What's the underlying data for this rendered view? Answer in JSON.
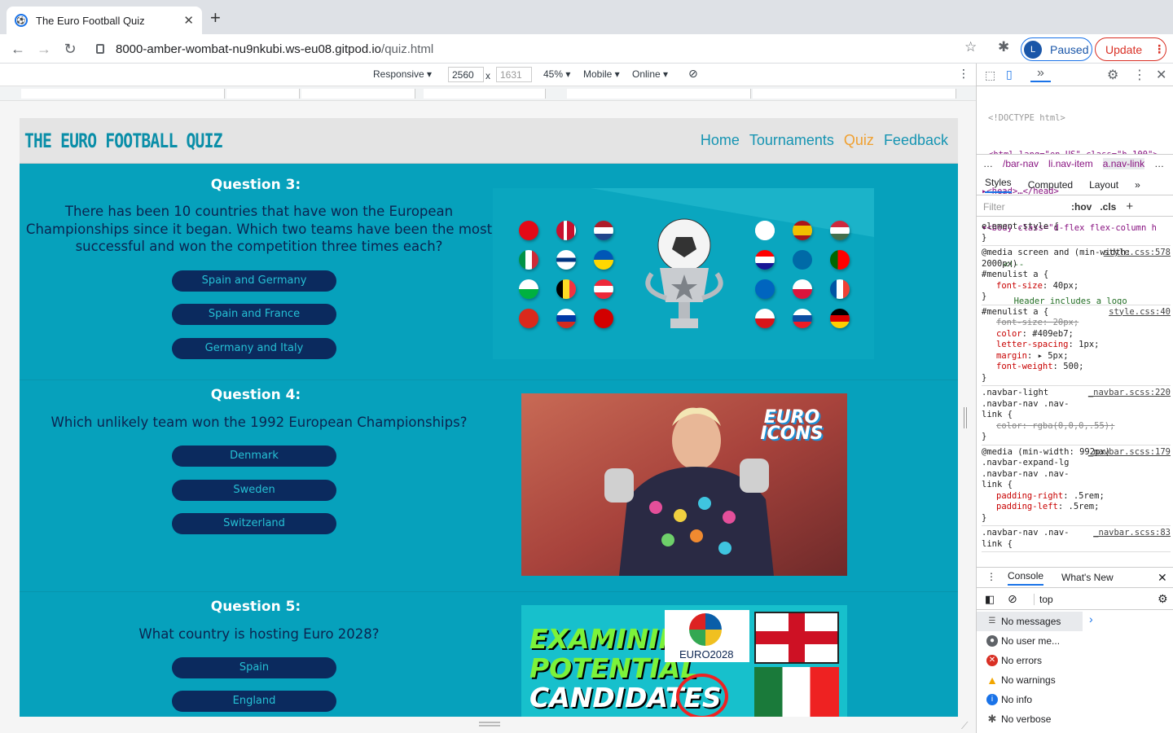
{
  "browser": {
    "tab_title": "The Euro Football Quiz",
    "tab_close": "✕",
    "new_tab": "+",
    "url_host": "8000-amber-wombat-nu9nkubi.ws-eu08.gitpod.io",
    "url_path": "/quiz.html",
    "profile_initial": "L",
    "profile_label": "Paused",
    "update_label": "Update"
  },
  "device_toolbar": {
    "mode": "Responsive ▾",
    "width": "2560",
    "times": "x",
    "height": "1631",
    "zoom": "45% ▾",
    "device": "Mobile ▾",
    "network": "Online ▾"
  },
  "page": {
    "logo": "THE EURO FOOTBALL QUIZ",
    "menu": [
      "Home",
      "Tournaments",
      "Quiz",
      "Feedback"
    ],
    "active_menu": "Quiz",
    "questions": [
      {
        "title": "Question 3:",
        "text": "There has been 10 countries that have won the European Championships since it began. Which two teams have been the most successful and won the competition three times each?",
        "answers": [
          "Spain and Germany",
          "Spain and France",
          "Germany and Italy"
        ]
      },
      {
        "title": "Question 4:",
        "text": "Which unlikely team won the 1992 European Championships?",
        "answers": [
          "Denmark",
          "Sweden",
          "Switzerland"
        ]
      },
      {
        "title": "Question 5:",
        "text": "What country is hosting Euro 2028?",
        "answers": [
          "Spain",
          "England"
        ]
      }
    ],
    "img2_badge": "EURO ICONS",
    "img3_text": [
      "EXAMINING",
      "POTENTIAL",
      "CANDIDATES"
    ],
    "img3_logo": "EURO2028"
  },
  "devtools": {
    "html_lines": [
      "<!DOCTYPE html>",
      "<html lang=\"en-US\" class=\"h-100\">",
      "▸<head>…</head>",
      "▾<body class=\"d-flex flex-column h",
      "   <!--",
      "     Header includes a logo"
    ],
    "crumbs": [
      "…",
      "/bar-nav",
      "li.nav-item",
      "a.nav-link",
      "…"
    ],
    "subtabs": [
      "Styles",
      "Computed",
      "Layout",
      "»"
    ],
    "filter_placeholder": "Filter",
    "filter_tools": [
      ":hov",
      ".cls",
      "+"
    ],
    "console_tabs": [
      "Console",
      "What's New"
    ],
    "console_context": "top",
    "console_items": [
      "No messages",
      "No user me...",
      "No errors",
      "No warnings",
      "No info",
      "No verbose"
    ],
    "rules": [
      {
        "selector": "element.style {",
        "source": "",
        "props": [],
        "close": "}"
      },
      {
        "selector": "@media screen and (min-width:\n2000px)\n#menulist a {",
        "source": "style.css:578",
        "props": [
          [
            "font-size",
            "40px;",
            false
          ]
        ],
        "close": "}"
      },
      {
        "selector": "#menulist a {",
        "source": "style.css:40",
        "props": [
          [
            "font-size",
            "20px;",
            true
          ],
          [
            "color",
            "#409eb7;",
            false
          ],
          [
            "letter-spacing",
            "1px;",
            false
          ],
          [
            "margin",
            "▸ 5px;",
            false
          ],
          [
            "font-weight",
            "500;",
            false
          ]
        ],
        "close": "}"
      },
      {
        "selector": ".navbar-light\n.navbar-nav .nav-\nlink {",
        "source": "_navbar.scss:220",
        "props": [
          [
            "color",
            "rgba(0,0,0,.55);",
            true
          ]
        ],
        "close": "}"
      },
      {
        "selector": "@media (min-width: 992px)\n.navbar-expand-lg\n.navbar-nav .nav-\nlink {",
        "source": "_navbar.scss:179",
        "props": [
          [
            "padding-right",
            ".5rem;",
            false
          ],
          [
            "padding-left",
            ".5rem;",
            false
          ]
        ],
        "close": "}"
      },
      {
        "selector": ".navbar-nav .nav-\nlink {",
        "source": "_navbar.scss:83",
        "props": [],
        "close": ""
      }
    ]
  },
  "colors": {
    "page_bg": "#06a1bc",
    "answer_bg": "#0b2a5e",
    "menu_link": "#1594b2",
    "menu_active": "#f0a030"
  }
}
